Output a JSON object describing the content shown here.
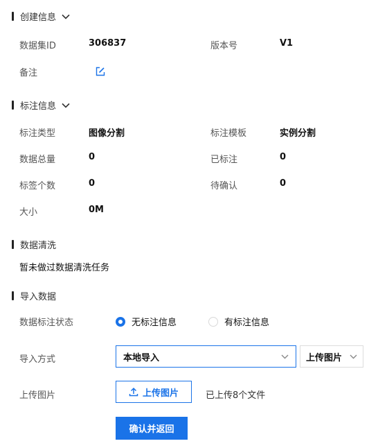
{
  "create_info": {
    "title": "创建信息",
    "dataset_id_label": "数据集ID",
    "dataset_id_value": "306837",
    "version_label": "版本号",
    "version_value": "V1",
    "remark_label": "备注"
  },
  "annotation_info": {
    "title": "标注信息",
    "type_label": "标注类型",
    "type_value": "图像分割",
    "template_label": "标注模板",
    "template_value": "实例分割",
    "total_label": "数据总量",
    "total_value": "0",
    "annotated_label": "已标注",
    "annotated_value": "0",
    "tag_count_label": "标签个数",
    "tag_count_value": "0",
    "pending_label": "待确认",
    "pending_value": "0",
    "size_label": "大小",
    "size_value": "0M"
  },
  "data_cleaning": {
    "title": "数据清洗",
    "message": "暂未做过数据清洗任务"
  },
  "import_data": {
    "title": "导入数据",
    "status_label": "数据标注状态",
    "radio_no_annotation": "无标注信息",
    "radio_has_annotation": "有标注信息",
    "method_label": "导入方式",
    "method_select": "本地导入",
    "upload_type_select": "上传图片",
    "upload_label": "上传图片",
    "upload_button": "上传图片",
    "uploaded_text": "已上传8个文件",
    "confirm_button": "确认并返回"
  },
  "colors": {
    "accent": "#1a73e8",
    "border": "#dcdcdc"
  },
  "icons": {
    "collapse": "chevron-down-icon",
    "edit": "edit-icon",
    "upload": "upload-icon"
  }
}
